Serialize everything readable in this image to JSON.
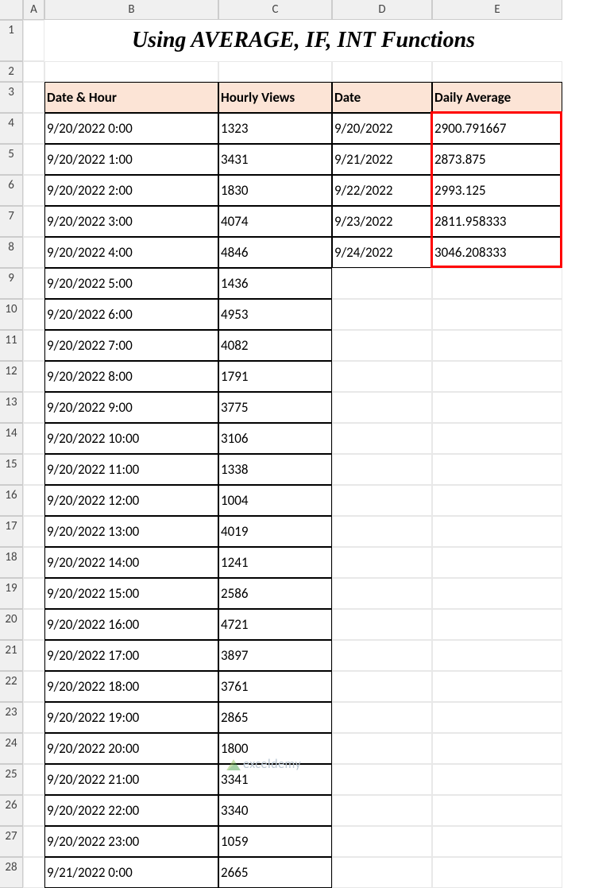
{
  "columns": [
    "A",
    "B",
    "C",
    "D",
    "E"
  ],
  "title": "Using AVERAGE, IF, INT Functions",
  "headers": {
    "b": "Date & Hour",
    "c": "Hourly Views",
    "d": "Date",
    "e": "Daily Average"
  },
  "rows": [
    {
      "r": 4,
      "b": "9/20/2022 0:00",
      "c": "1323",
      "d": "9/20/2022",
      "e": "2900.791667"
    },
    {
      "r": 5,
      "b": "9/20/2022 1:00",
      "c": "3431",
      "d": "9/21/2022",
      "e": "2873.875"
    },
    {
      "r": 6,
      "b": "9/20/2022 2:00",
      "c": "1830",
      "d": "9/22/2022",
      "e": "2993.125"
    },
    {
      "r": 7,
      "b": "9/20/2022 3:00",
      "c": "4074",
      "d": "9/23/2022",
      "e": "2811.958333"
    },
    {
      "r": 8,
      "b": "9/20/2022 4:00",
      "c": "4846",
      "d": "9/24/2022",
      "e": "3046.208333"
    },
    {
      "r": 9,
      "b": "9/20/2022 5:00",
      "c": "1436"
    },
    {
      "r": 10,
      "b": "9/20/2022 6:00",
      "c": "4953"
    },
    {
      "r": 11,
      "b": "9/20/2022 7:00",
      "c": "4082"
    },
    {
      "r": 12,
      "b": "9/20/2022 8:00",
      "c": "1791"
    },
    {
      "r": 13,
      "b": "9/20/2022 9:00",
      "c": "3775"
    },
    {
      "r": 14,
      "b": "9/20/2022 10:00",
      "c": "3106"
    },
    {
      "r": 15,
      "b": "9/20/2022 11:00",
      "c": "1338"
    },
    {
      "r": 16,
      "b": "9/20/2022 12:00",
      "c": "1004"
    },
    {
      "r": 17,
      "b": "9/20/2022 13:00",
      "c": "4019"
    },
    {
      "r": 18,
      "b": "9/20/2022 14:00",
      "c": "1241"
    },
    {
      "r": 19,
      "b": "9/20/2022 15:00",
      "c": "2586"
    },
    {
      "r": 20,
      "b": "9/20/2022 16:00",
      "c": "4721"
    },
    {
      "r": 21,
      "b": "9/20/2022 17:00",
      "c": "3897"
    },
    {
      "r": 22,
      "b": "9/20/2022 18:00",
      "c": "3761"
    },
    {
      "r": 23,
      "b": "9/20/2022 19:00",
      "c": "2865"
    },
    {
      "r": 24,
      "b": "9/20/2022 20:00",
      "c": "1800"
    },
    {
      "r": 25,
      "b": "9/20/2022 21:00",
      "c": "3341"
    },
    {
      "r": 26,
      "b": "9/20/2022 22:00",
      "c": "3340"
    },
    {
      "r": 27,
      "b": "9/20/2022 23:00",
      "c": "1059"
    },
    {
      "r": 28,
      "b": "9/21/2022 0:00",
      "c": "2665"
    }
  ],
  "watermark": "exceldemy"
}
